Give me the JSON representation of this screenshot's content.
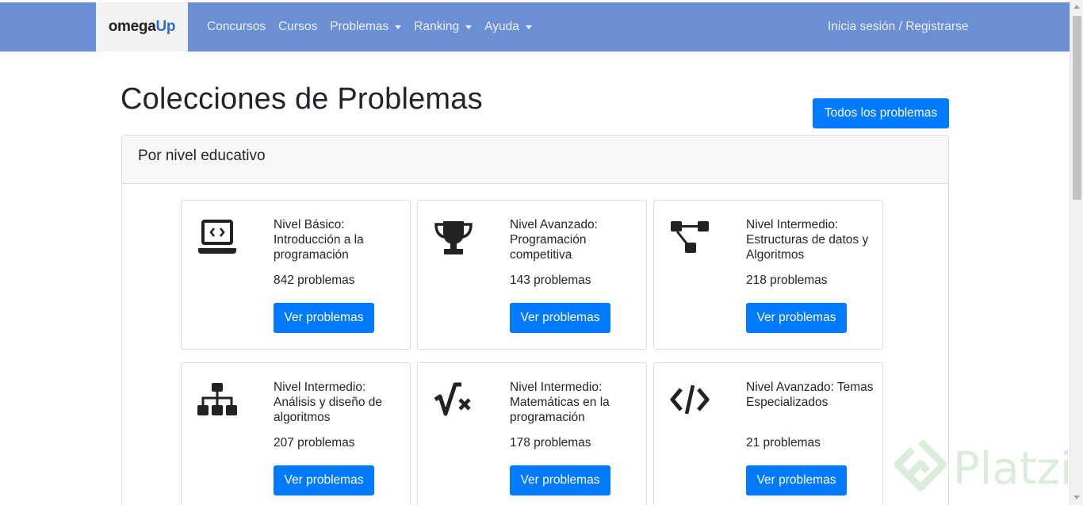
{
  "brand": {
    "part1": "omega",
    "part2": "Up"
  },
  "nav": {
    "items": [
      {
        "label": "Concursos",
        "dropdown": false
      },
      {
        "label": "Cursos",
        "dropdown": false
      },
      {
        "label": "Problemas",
        "dropdown": true
      },
      {
        "label": "Ranking",
        "dropdown": true
      },
      {
        "label": "Ayuda",
        "dropdown": true
      }
    ],
    "login": "Inicia sesión / Registrarse"
  },
  "page": {
    "title": "Colecciones de Problemas",
    "all_button": "Todos los problemas"
  },
  "panel": {
    "title": "Por nivel educativo",
    "cards": [
      {
        "icon": "laptop-code-icon",
        "title": "Nivel Básico: Introducción a la programación",
        "count": "842 problemas",
        "button": "Ver problemas"
      },
      {
        "icon": "trophy-icon",
        "title": "Nivel Avanzado: Programación competitiva",
        "count": "143 problemas",
        "button": "Ver problemas"
      },
      {
        "icon": "project-diagram-icon",
        "title": "Nivel Intermedio: Estructuras de datos y Algoritmos",
        "count": "218 problemas",
        "button": "Ver problemas"
      },
      {
        "icon": "sitemap-icon",
        "title": "Nivel Intermedio: Análisis y diseño de algoritmos",
        "count": "207 problemas",
        "button": "Ver problemas"
      },
      {
        "icon": "square-root-icon",
        "title": "Nivel Intermedio: Matemáticas en la programación",
        "count": "178 problemas",
        "button": "Ver problemas"
      },
      {
        "icon": "code-icon",
        "title": "Nivel Avanzado: Temas Especializados",
        "count": "21 problemas",
        "button": "Ver problemas"
      }
    ]
  },
  "watermark": {
    "text": "Platzi"
  },
  "colors": {
    "navbar": "#6b8fd4",
    "primary": "#007bff",
    "brand_accent": "#2f6ec8"
  }
}
